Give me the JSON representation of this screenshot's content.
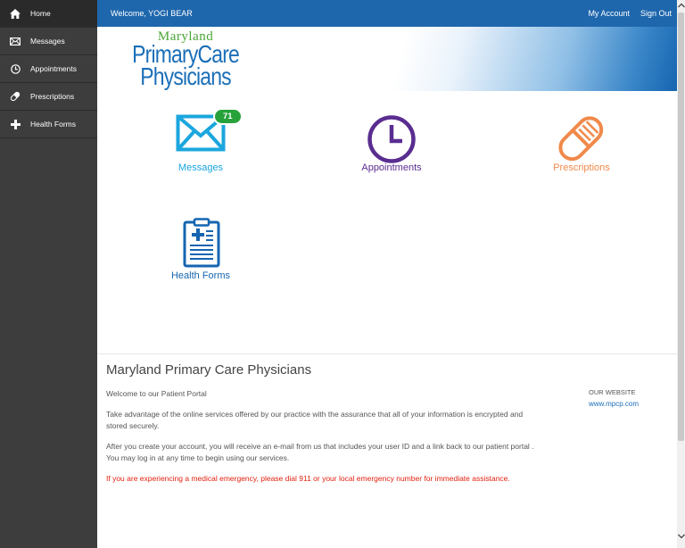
{
  "sidebar": {
    "items": [
      {
        "label": "Home",
        "icon": "home-icon"
      },
      {
        "label": "Messages",
        "icon": "envelope-icon"
      },
      {
        "label": "Appointments",
        "icon": "clock-icon"
      },
      {
        "label": "Prescriptions",
        "icon": "pill-icon"
      },
      {
        "label": "Health Forms",
        "icon": "plus-icon"
      }
    ]
  },
  "topbar": {
    "welcome": "Welcome, YOGI BEAR",
    "my_account": "My Account",
    "sign_out": "Sign Out"
  },
  "logo": {
    "line1": "Maryland",
    "line2": "PrimaryCare",
    "line3": "Physicians"
  },
  "tiles": {
    "messages": {
      "label": "Messages",
      "badge": "71",
      "color": "#1ba6de"
    },
    "appointments": {
      "label": "Appointments",
      "color": "#5a2d91"
    },
    "prescriptions": {
      "label": "Prescriptions",
      "color": "#f0894a"
    },
    "health_forms": {
      "label": "Health Forms",
      "color": "#1565b0"
    }
  },
  "info": {
    "title": "Maryland Primary Care Physicians",
    "welcome": "Welcome to our Patient Portal",
    "p1": "Take advantage of the online services offered by our practice with the assurance that all of your information is encrypted and stored securely.",
    "p2": "After you create your account, you will receive an e-mail from us that includes your user ID and a link back to our patient portal . You may log in at any time to begin using our services.",
    "emergency": "If you are experiencing a medical emergency, please dial 911 or your local emergency number for immediate assistance."
  },
  "website": {
    "heading": "OUR WEBSITE",
    "link": "www.mpcp.com"
  }
}
